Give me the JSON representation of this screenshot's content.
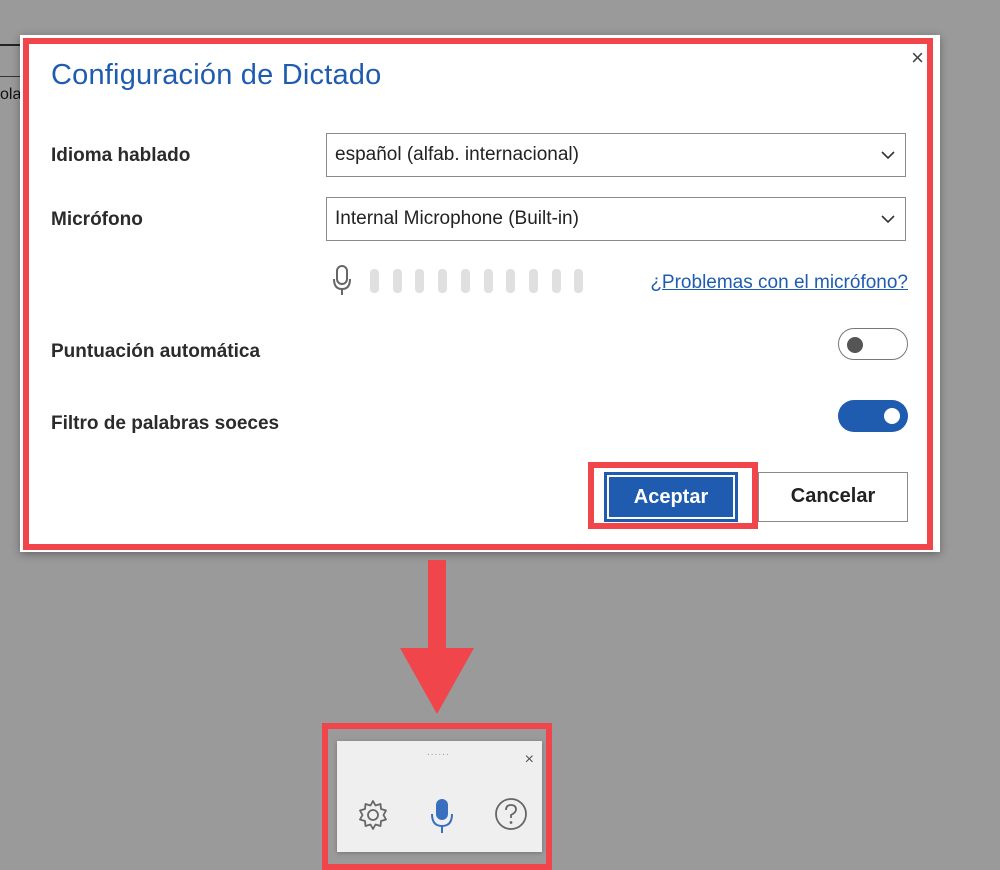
{
  "background": {
    "text_fragment": "ola"
  },
  "dialog": {
    "title": "Configuración de Dictado",
    "close_glyph": "×",
    "language": {
      "label": "Idioma hablado",
      "selected": "español (alfab. internacional)"
    },
    "microphone": {
      "label": "Micrófono",
      "selected": "Internal Microphone (Built-in)",
      "level_bars": 10,
      "help_link": "¿Problemas con el micrófono?"
    },
    "auto_punctuation": {
      "label": "Puntuación automática",
      "enabled": false
    },
    "profanity_filter": {
      "label": "Filtro de palabras soeces",
      "enabled": true
    },
    "buttons": {
      "accept": "Aceptar",
      "cancel": "Cancelar"
    }
  },
  "toolbar": {
    "grip": "......",
    "close_glyph": "×",
    "icons": [
      "gear-icon",
      "microphone-icon",
      "help-icon"
    ]
  },
  "colors": {
    "accent": "#1f5cb0",
    "annotation": "#f0454b",
    "overlay": "#9a9a9a"
  }
}
